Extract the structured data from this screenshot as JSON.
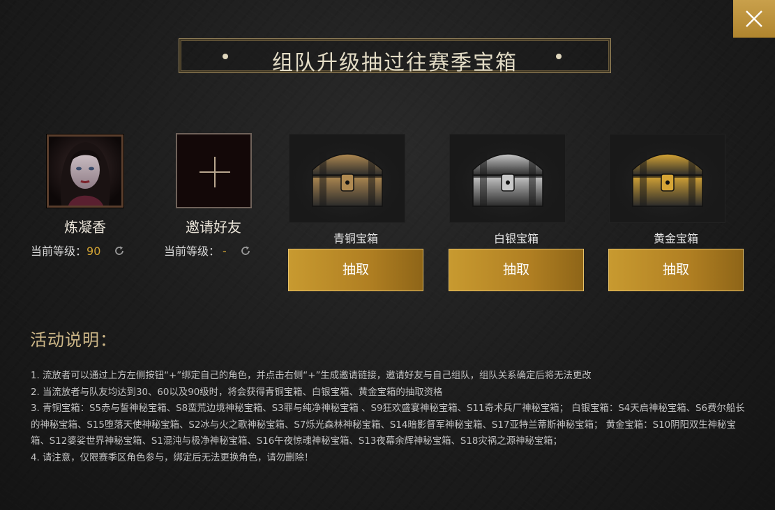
{
  "title": "组队升级抽过往赛季宝箱",
  "close_icon": "close-icon",
  "player": {
    "name": "炼凝香",
    "level_label": "当前等级：",
    "level_value": "90"
  },
  "invite": {
    "name": "邀请好友",
    "level_label": "当前等级：",
    "level_value": "-"
  },
  "chests": [
    {
      "label": "青铜宝箱",
      "button": "抽取",
      "tint": "#b08a52"
    },
    {
      "label": "白银宝箱",
      "button": "抽取",
      "tint": "#c8c8c8"
    },
    {
      "label": "黄金宝箱",
      "button": "抽取",
      "tint": "#d6a536"
    }
  ],
  "description": {
    "title": "活动说明：",
    "lines": [
      "1. 流放者可以通过上方左侧按钮“+”绑定自己的角色，并点击右侧“+”生成邀请链接，邀请好友与自己组队，组队关系确定后将无法更改",
      "2. 当流放者与队友均达到30、60以及90级时，将会获得青铜宝箱、白银宝箱、黄金宝箱的抽取资格",
      "3. 青铜宝箱：S5赤与誓神秘宝箱、S8蛮荒边境神秘宝箱、S3罪与纯净神秘宝箱 、S9狂欢盛宴神秘宝箱、S11奇术兵厂神秘宝箱； 白银宝箱：S4天启神秘宝箱、S6费尔船长的神秘宝箱、S15堕落天使神秘宝箱、S2冰与火之歌神秘宝箱、S7烁光森林神秘宝箱、S14暗影督军神秘宝箱、S17亚特兰蒂斯神秘宝箱； 黄金宝箱：S10阴阳双生神秘宝箱、S12婆娑世界神秘宝箱、S1混沌与极净神秘宝箱、S16午夜惊魂神秘宝箱、S13夜幕余辉神秘宝箱、S18灾祸之源神秘宝箱；",
      "4. 请注意，仅限赛季区角色参与，绑定后无法更换角色，请勿删除！"
    ]
  }
}
